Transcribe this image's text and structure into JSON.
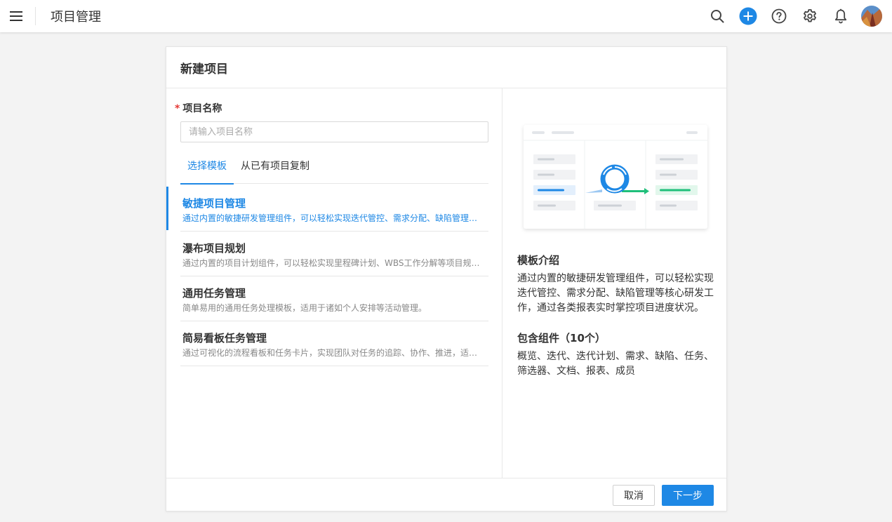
{
  "header": {
    "app_title": "项目管理",
    "icons": [
      "menu-icon",
      "search-icon",
      "plus-circle-icon",
      "help-icon",
      "gear-icon",
      "bell-icon",
      "avatar"
    ]
  },
  "dialog": {
    "title": "新建项目",
    "name_field": {
      "label": "项目名称",
      "required_mark": "*",
      "placeholder": "请输入项目名称",
      "value": ""
    },
    "tabs": [
      {
        "label": "选择模板",
        "active": true
      },
      {
        "label": "从已有项目复制",
        "active": false
      }
    ],
    "templates": [
      {
        "name": "敏捷项目管理",
        "desc": "通过内置的敏捷研发管理组件，可以轻松实现迭代管控、需求分配、缺陷管理等核心研发工作，通过各类报表实时掌控项目进度状况。",
        "selected": true
      },
      {
        "name": "瀑布项目规划",
        "desc": "通过内置的项目计划组件，可以轻松实现里程碑计划、WBS工作分解等项目规划与管理工作。",
        "selected": false
      },
      {
        "name": "通用任务管理",
        "desc": "简单易用的通用任务处理模板，适用于诸如个人安排等活动管理。",
        "selected": false
      },
      {
        "name": "简易看板任务管理",
        "desc": "通过可视化的流程看板和任务卡片，实现团队对任务的追踪、协作、推进，适用于敏捷团队。",
        "selected": false
      }
    ],
    "preview": {
      "intro_title": "模板介绍",
      "intro_text": "通过内置的敏捷研发管理组件，可以轻松实现迭代管控、需求分配、缺陷管理等核心研发工作，通过各类报表实时掌控项目进度状况。",
      "components_title": "包含组件（10个）",
      "components_text": "概览、迭代、迭代计划、需求、缺陷、任务、筛选器、文档、报表、成员"
    },
    "footer": {
      "cancel_label": "取消",
      "next_label": "下一步"
    }
  },
  "colors": {
    "accent": "#1e88e5",
    "success": "#1fbf7a",
    "required": "#e53935"
  }
}
